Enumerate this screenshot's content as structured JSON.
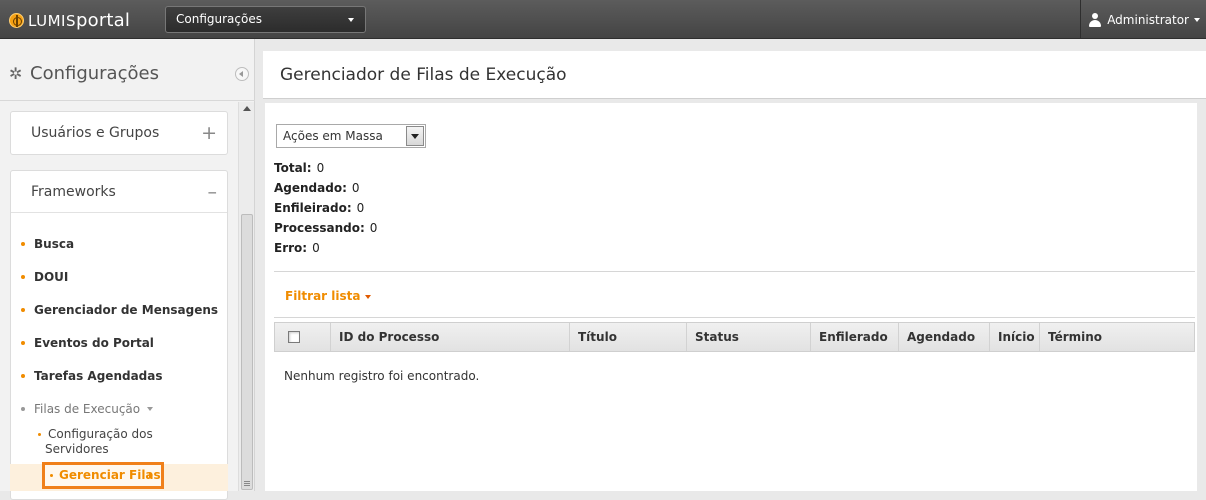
{
  "topbar": {
    "logo_prefix": "LUMIS",
    "logo_suffix": "portal",
    "app_selector_value": "Configurações",
    "user_name": "Administrator"
  },
  "sidebar": {
    "title": "Configurações",
    "panels": [
      {
        "label": "Usuários e Grupos",
        "toggle": "+"
      },
      {
        "label": "Frameworks",
        "toggle": "–"
      }
    ],
    "items": [
      {
        "label": "Busca"
      },
      {
        "label": "DOUI"
      },
      {
        "label": "Gerenciador de Mensagens"
      },
      {
        "label": "Eventos do Portal"
      },
      {
        "label": "Tarefas Agendadas"
      }
    ],
    "group": {
      "label": "Filas de Execução"
    },
    "sub_items": [
      {
        "label_line1": "Configuração dos",
        "label_line2": "Servidores"
      }
    ],
    "active_item": {
      "label": "Gerenciar Filas"
    }
  },
  "main": {
    "title": "Gerenciador de Filas de Execução",
    "bulk_actions": "Ações em Massa",
    "stats": [
      {
        "label": "Total:",
        "value": "0"
      },
      {
        "label": "Agendado:",
        "value": "0"
      },
      {
        "label": "Enfileirado:",
        "value": "0"
      },
      {
        "label": "Processando:",
        "value": "0"
      },
      {
        "label": "Erro:",
        "value": "0"
      }
    ],
    "filter_label": "Filtrar lista",
    "table": {
      "columns": [
        "ID do Processo",
        "Título",
        "Status",
        "Enfilerado",
        "Agendado",
        "Início",
        "Término"
      ],
      "empty_message": "Nenhum registro foi encontrado."
    }
  },
  "colors": {
    "accent": "#f08c00",
    "topbar": "#4a4a4a",
    "highlight_border": "#f0801a"
  }
}
